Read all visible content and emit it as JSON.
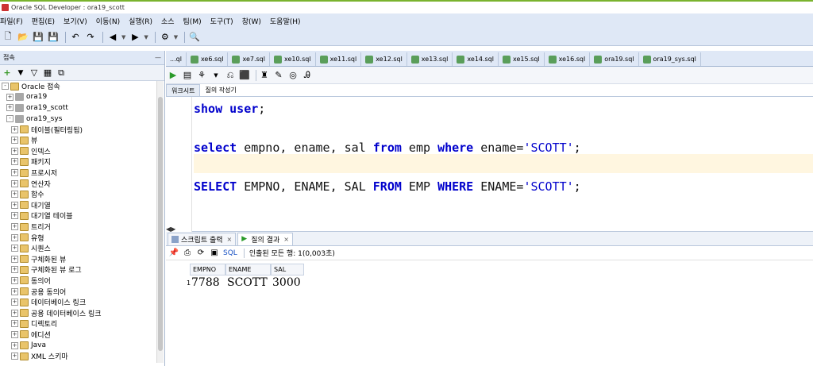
{
  "window": {
    "title": "Oracle SQL Developer : ora19_scott"
  },
  "menu": [
    "파일(F)",
    "편집(E)",
    "보기(V)",
    "이동(N)",
    "실행(R)",
    "소스",
    "팀(M)",
    "도구(T)",
    "창(W)",
    "도움말(H)"
  ],
  "connections_panel": {
    "title": "접속",
    "tree": [
      {
        "label": "Oracle 접속",
        "level": 0,
        "icon": "folder-icon",
        "expander": "-"
      },
      {
        "label": "ora19",
        "level": 1,
        "icon": "database-icon",
        "expander": "+"
      },
      {
        "label": "ora19_scott",
        "level": 1,
        "icon": "database-icon",
        "expander": "+"
      },
      {
        "label": "ora19_sys",
        "level": 1,
        "icon": "database-icon",
        "expander": "-"
      },
      {
        "label": "테이블(필터링됨)",
        "level": 2,
        "icon": "folder-icon",
        "expander": "+"
      },
      {
        "label": "뷰",
        "level": 2,
        "icon": "folder-icon",
        "expander": "+"
      },
      {
        "label": "인덱스",
        "level": 2,
        "icon": "folder-icon",
        "expander": "+"
      },
      {
        "label": "패키지",
        "level": 2,
        "icon": "folder-icon",
        "expander": "+"
      },
      {
        "label": "프로시저",
        "level": 2,
        "icon": "folder-icon",
        "expander": "+"
      },
      {
        "label": "연산자",
        "level": 2,
        "icon": "folder-icon",
        "expander": "+"
      },
      {
        "label": "함수",
        "level": 2,
        "icon": "folder-icon",
        "expander": "+"
      },
      {
        "label": "대기열",
        "level": 2,
        "icon": "folder-icon",
        "expander": "+"
      },
      {
        "label": "대기열 테이블",
        "level": 2,
        "icon": "folder-icon",
        "expander": "+"
      },
      {
        "label": "트리거",
        "level": 2,
        "icon": "folder-icon",
        "expander": "+"
      },
      {
        "label": "유형",
        "level": 2,
        "icon": "folder-icon",
        "expander": "+"
      },
      {
        "label": "시퀀스",
        "level": 2,
        "icon": "folder-icon",
        "expander": "+"
      },
      {
        "label": "구체화된 뷰",
        "level": 2,
        "icon": "folder-icon",
        "expander": "+"
      },
      {
        "label": "구체화된 뷰 로그",
        "level": 2,
        "icon": "folder-icon",
        "expander": "+"
      },
      {
        "label": "동의어",
        "level": 2,
        "icon": "folder-icon",
        "expander": "+"
      },
      {
        "label": "공용 동의어",
        "level": 2,
        "icon": "folder-icon",
        "expander": "+"
      },
      {
        "label": "데이터베이스 링크",
        "level": 2,
        "icon": "folder-icon",
        "expander": "+"
      },
      {
        "label": "공용 데이터베이스 링크",
        "level": 2,
        "icon": "folder-icon",
        "expander": "+"
      },
      {
        "label": "디렉토리",
        "level": 2,
        "icon": "folder-icon",
        "expander": "+"
      },
      {
        "label": "에디션",
        "level": 2,
        "icon": "folder-icon",
        "expander": "+"
      },
      {
        "label": "Java",
        "level": 2,
        "icon": "folder-icon",
        "expander": "+"
      },
      {
        "label": "XML 스키마",
        "level": 2,
        "icon": "folder-icon",
        "expander": "+"
      }
    ]
  },
  "doc_tabs": [
    "...ql",
    "xe6.sql",
    "xe7.sql",
    "xe10.sql",
    "xe11.sql",
    "xe12.sql",
    "xe13.sql",
    "xe14.sql",
    "xe15.sql",
    "xe16.sql",
    "ora19.sql",
    "ora19_sys.sql"
  ],
  "editor_subtabs": {
    "worksheet": "워크시트",
    "query_builder": "질의 작성기"
  },
  "code": {
    "line1_kw": "show user",
    "line1_rest": ";",
    "line2": [
      {
        "t": "select",
        "k": "kw"
      },
      {
        "t": " empno, ename, sal ",
        "k": "plain"
      },
      {
        "t": "from",
        "k": "kw"
      },
      {
        "t": " emp ",
        "k": "plain"
      },
      {
        "t": "where",
        "k": "kw"
      },
      {
        "t": " ename=",
        "k": "plain"
      },
      {
        "t": "'SCOTT'",
        "k": "str"
      },
      {
        "t": ";",
        "k": "plain"
      }
    ],
    "line3": [
      {
        "t": "SELECT",
        "k": "kw"
      },
      {
        "t": " EMPNO, ENAME, SAL ",
        "k": "plain"
      },
      {
        "t": "FROM",
        "k": "kw"
      },
      {
        "t": " EMP ",
        "k": "plain"
      },
      {
        "t": "WHERE",
        "k": "kw"
      },
      {
        "t": " ENAME=",
        "k": "plain"
      },
      {
        "t": "'SCOTT'",
        "k": "str"
      },
      {
        "t": ";",
        "k": "plain"
      }
    ]
  },
  "output": {
    "script_tab": "스크립트 출력",
    "result_tab": "질의 결과",
    "sql_link": "SQL",
    "status": "인출된 모든 행: 1(0,003초)",
    "columns": [
      "EMPNO",
      "ENAME",
      "SAL"
    ],
    "rows": [
      {
        "num": "1",
        "cells": [
          "7788",
          "SCOTT",
          "3000"
        ]
      }
    ]
  },
  "colors": {
    "accent": "#7ab32e",
    "keyword": "#0000cc",
    "chrome": "#dfe8f6"
  }
}
